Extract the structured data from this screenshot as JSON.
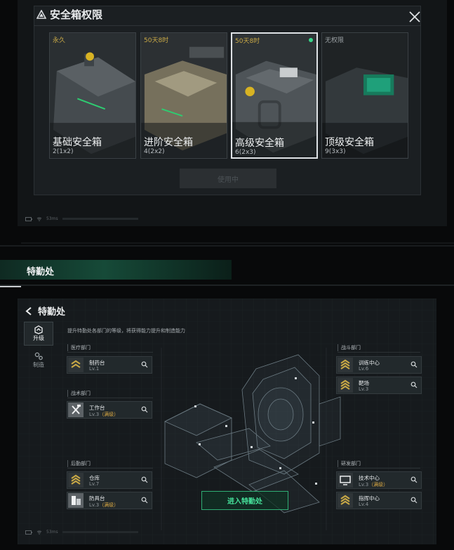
{
  "safebox": {
    "title": "安全箱权限",
    "use_button": "使用中",
    "ping": "53ms",
    "cards": [
      {
        "tag": "永久",
        "name": "基础安全箱",
        "capacity": "2(1x2)",
        "tag_color": "#c9a946"
      },
      {
        "tag": "50天8时",
        "name": "进阶安全箱",
        "capacity": "4(2x2)",
        "tag_color": "#c9a946"
      },
      {
        "tag": "50天8时",
        "name": "高级安全箱",
        "capacity": "6(2x3)",
        "tag_color": "#c9a946"
      },
      {
        "tag": "无权限",
        "name": "顶级安全箱",
        "capacity": "9(3x3)",
        "tag_color": "#9aa0a4"
      }
    ]
  },
  "banner": {
    "title": "特勤处"
  },
  "hq": {
    "title": "特勤处",
    "description": "提升特勤处各部门的等级，将获得能力提升和制造能力",
    "tabs": [
      {
        "label": "升级",
        "icon": "upgrade-icon"
      },
      {
        "label": "制造",
        "icon": "gear-icon"
      }
    ],
    "ping": "53ms",
    "enter_button": "进入特勤处",
    "departments": {
      "medical": {
        "label": "医疗部门",
        "items": [
          {
            "name": "制药台",
            "level": "Lv.1",
            "max": ""
          }
        ]
      },
      "tactical": {
        "label": "战术部门",
        "items": [
          {
            "name": "工作台",
            "level": "Lv.3",
            "max": "（满级）"
          }
        ]
      },
      "logistics": {
        "label": "后勤部门",
        "items": [
          {
            "name": "仓库",
            "level": "Lv.7",
            "max": ""
          },
          {
            "name": "防具台",
            "level": "Lv.3",
            "max": "（满级）"
          }
        ]
      },
      "combat": {
        "label": "战斗部门",
        "items": [
          {
            "name": "训练中心",
            "level": "Lv.6",
            "max": ""
          },
          {
            "name": "靶场",
            "level": "Lv.3",
            "max": ""
          }
        ]
      },
      "research": {
        "label": "研发部门",
        "items": [
          {
            "name": "技术中心",
            "level": "Lv.3",
            "max": "（满级）"
          },
          {
            "name": "指挥中心",
            "level": "Lv.4",
            "max": ""
          }
        ]
      }
    }
  },
  "colors": {
    "accent_green": "#46e29b",
    "max_level": "#d8a742",
    "chevron_gold": "#c9a946"
  }
}
